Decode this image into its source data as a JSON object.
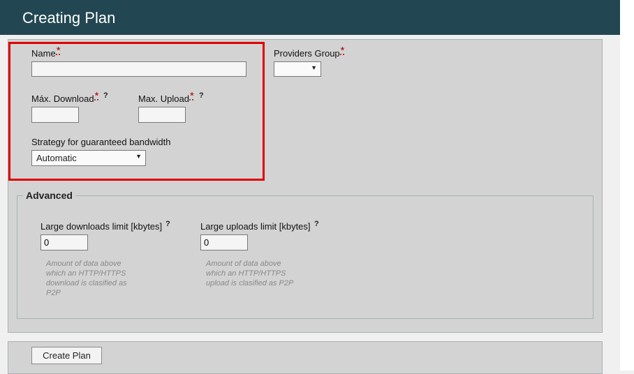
{
  "header": {
    "title": "Creating Plan"
  },
  "form": {
    "required_marker": "*",
    "help_marker": "?",
    "name": {
      "label": "Name",
      "value": ""
    },
    "providers_group": {
      "label": "Providers Group",
      "value": ""
    },
    "max_download": {
      "label": "Máx. Download",
      "value": ""
    },
    "max_upload": {
      "label": "Max. Upload",
      "value": ""
    },
    "strategy": {
      "label": "Strategy for guaranteed bandwidth",
      "value": "Automatic"
    }
  },
  "advanced": {
    "legend": "Advanced",
    "large_downloads": {
      "label": "Large downloads limit [kbytes]",
      "value": "0",
      "hint": [
        "Amount of data above",
        "which an HTTP/HTTPS",
        "download is clasified as",
        "P2P"
      ]
    },
    "large_uploads": {
      "label": "Large uploads limit [kbytes]",
      "value": "0",
      "hint": [
        "Amount of data above",
        "which an HTTP/HTTPS",
        "upload is clasified as P2P"
      ]
    }
  },
  "actions": {
    "create_label": "Create Plan"
  },
  "colors": {
    "header_bg": "#234752",
    "highlight": "#e00000",
    "panel_bg": "#d3d3d3"
  }
}
